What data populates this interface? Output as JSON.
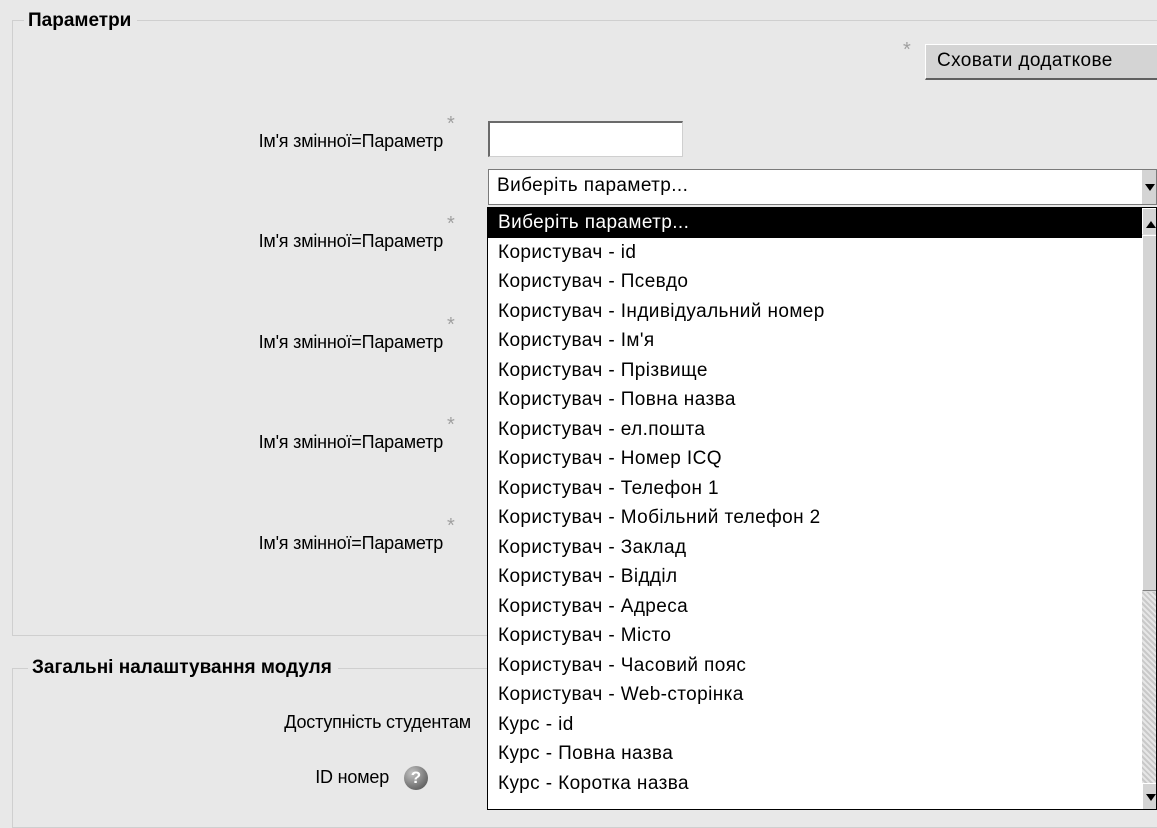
{
  "sections": {
    "parameters": "Параметри",
    "general": "Загальні налаштування модуля"
  },
  "required_mark": "*",
  "hide_advanced_button": "Сховати додаткове",
  "param_label": "Ім'я змінної=Параметр",
  "param_input_value": "",
  "select": {
    "selected": "Виберіть параметр...",
    "options": [
      "Виберіть параметр...",
      "Користувач - id",
      "Користувач - Псевдо",
      "Користувач - Індивідуальний номер",
      "Користувач - Ім'я",
      "Користувач - Прізвище",
      "Користувач - Повна назва",
      "Користувач - ел.пошта",
      "Користувач - Номер ICQ",
      "Користувач - Телефон 1",
      "Користувач - Мобільний телефон 2",
      "Користувач - Заклад",
      "Користувач - Відділ",
      "Користувач - Адреса",
      "Користувач - Місто",
      "Користувач - Часовий пояс",
      "Користувач - Web-сторінка",
      "Курс - id",
      "Курс - Повна назва",
      "Курс - Коротка назва"
    ]
  },
  "general": {
    "visibility_label": "Доступність студентам",
    "id_label": "ID номер",
    "help_icon": "question-mark-icon",
    "help_glyph": "?"
  }
}
